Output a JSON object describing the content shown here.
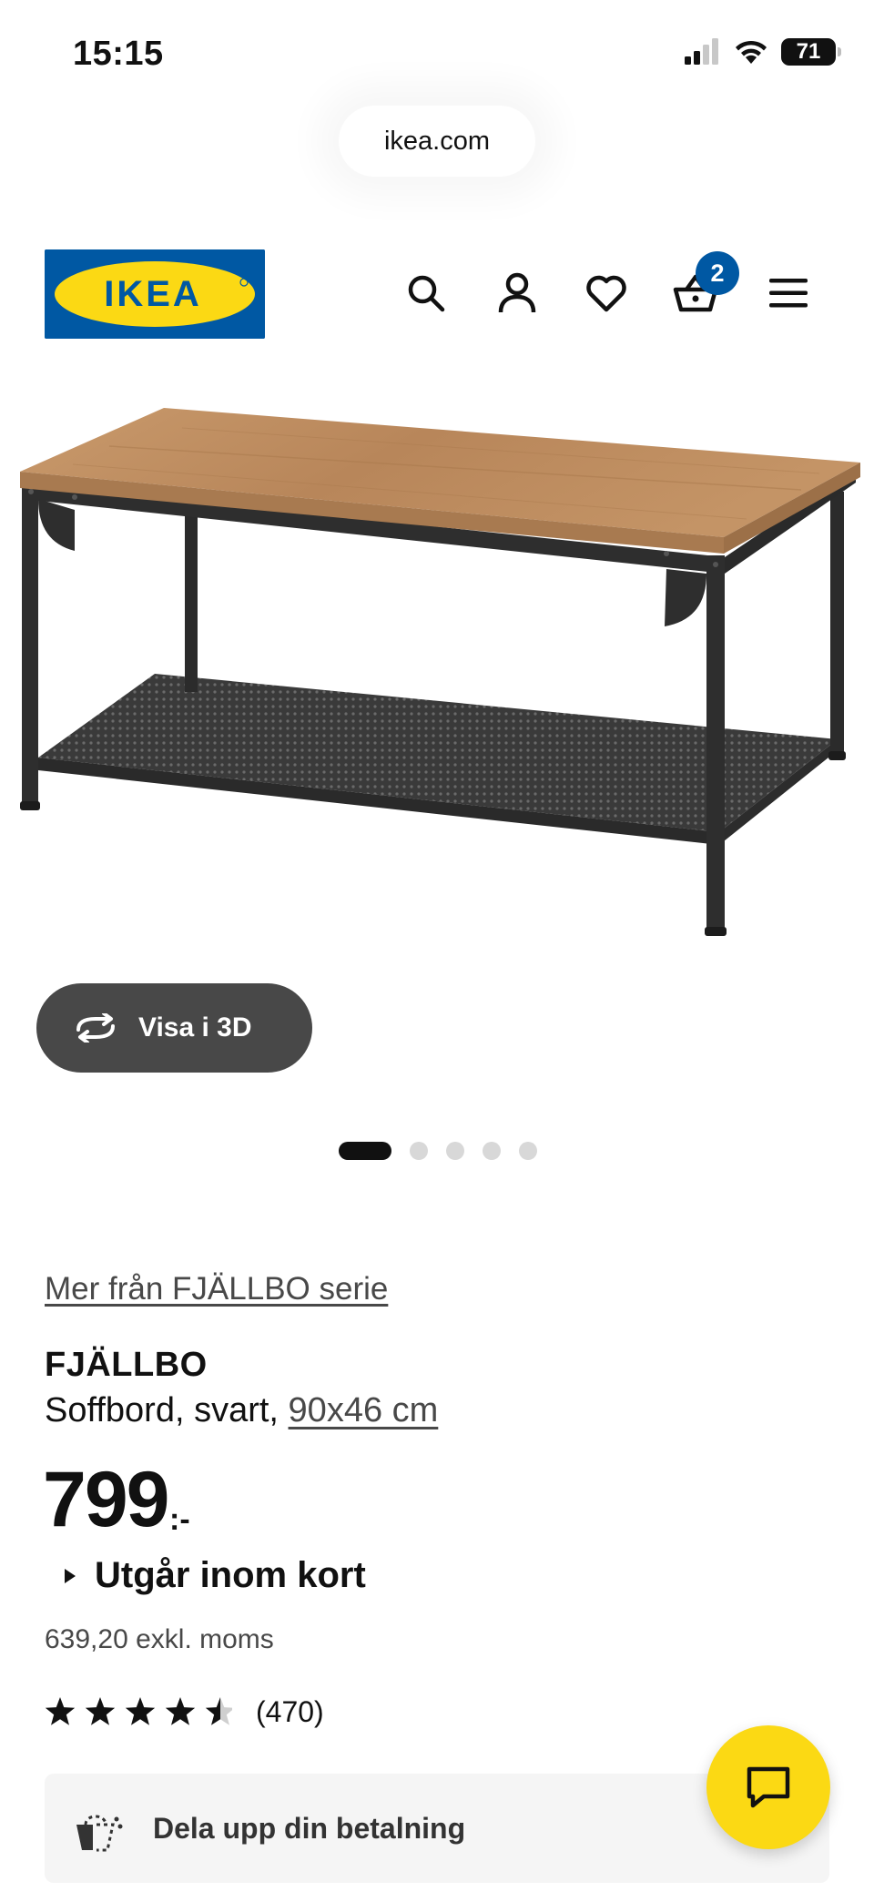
{
  "status_bar": {
    "time": "15:15",
    "battery": "71"
  },
  "browser": {
    "url": "ikea.com"
  },
  "header": {
    "logo_text": "IKEA",
    "cart_count": "2"
  },
  "gallery": {
    "view_3d_label": "Visa i 3D",
    "image_count": 5,
    "active_index": 0
  },
  "product": {
    "series_link": "Mer från FJÄLLBO serie",
    "name": "FJÄLLBO",
    "description": "Soffbord, svart,",
    "size": "90x46 cm",
    "price": "799",
    "price_suffix": ":-",
    "availability": "Utgår inom kort",
    "price_excl_vat": "639,20 exkl. moms",
    "rating": 4.5,
    "review_count": "(470)"
  },
  "payment": {
    "label": "Dela upp din betalning"
  },
  "colors": {
    "ikea_blue": "#0058a3",
    "ikea_yellow": "#fbd914",
    "chat_yellow": "#fbd914"
  }
}
